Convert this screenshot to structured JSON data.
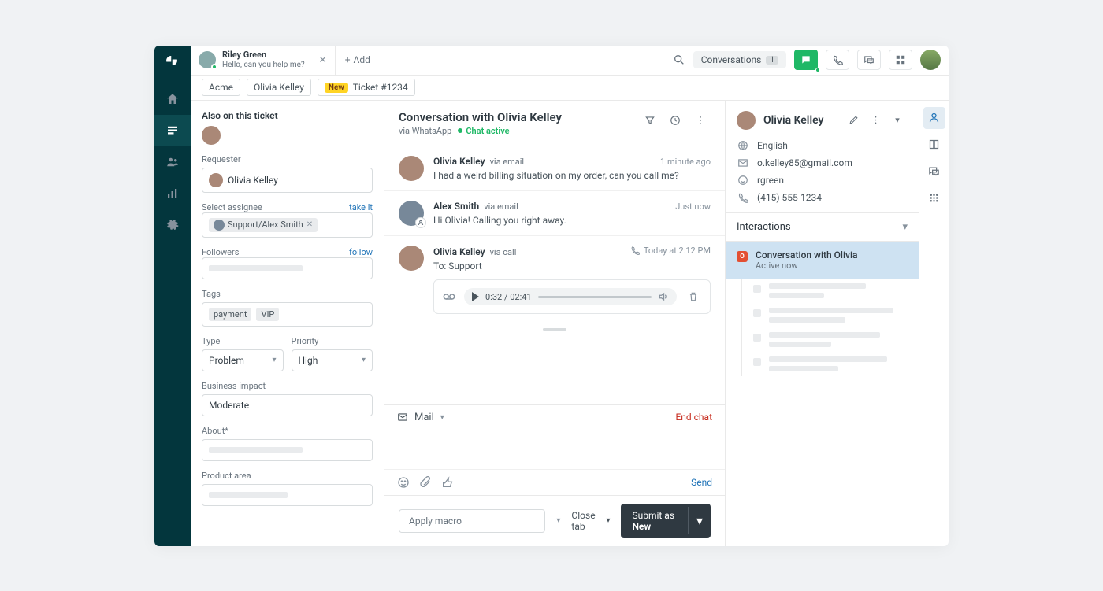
{
  "topbar": {
    "tab": {
      "name": "Riley Green",
      "preview": "Hello, can you help me?"
    },
    "add": "Add",
    "conversations": {
      "label": "Conversations",
      "count": "1"
    }
  },
  "breadcrumb": {
    "org": "Acme",
    "user": "Olivia Kelley",
    "ticket_badge": "New",
    "ticket": "Ticket #1234"
  },
  "left": {
    "also_on": "Also on this ticket",
    "requester_label": "Requester",
    "requester": "Olivia Kelley",
    "assignee_label": "Select assignee",
    "take_it": "take it",
    "assignee_chip": "Support/Alex Smith",
    "followers_label": "Followers",
    "follow": "follow",
    "tags_label": "Tags",
    "tag1": "payment",
    "tag2": "VIP",
    "type_label": "Type",
    "type_value": "Problem",
    "priority_label": "Priority",
    "priority_value": "High",
    "impact_label": "Business impact",
    "impact_value": "Moderate",
    "about_label": "About*",
    "product_label": "Product area"
  },
  "conversation": {
    "title": "Conversation with Olivia Kelley",
    "via": "via WhatsApp",
    "status": "Chat active",
    "messages": [
      {
        "author": "Olivia Kelley",
        "via": "via email",
        "time": "1 minute ago",
        "text": "I had a weird billing situation on my order, can you call me?"
      },
      {
        "author": "Alex Smith",
        "via": "via email",
        "time": "Just now",
        "text": "Hi Olivia! Calling you right away."
      },
      {
        "author": "Olivia Kelley",
        "via": "via call",
        "time": "Today at 2:12 PM",
        "to": "To: Support",
        "player_time": "0:32 / 02:41"
      }
    ],
    "reply_channel": "Mail",
    "end_chat": "End chat",
    "send": "Send",
    "macro": "Apply macro",
    "close_tab": "Close tab",
    "submit_prefix": "Submit as ",
    "submit_status": "New"
  },
  "customer": {
    "name": "Olivia Kelley",
    "language": "English",
    "email": "o.kelley85@gmail.com",
    "whatsapp": "rgreen",
    "phone": "(415) 555-1234",
    "interactions_title": "Interactions",
    "active_interaction": {
      "title": "Conversation with Olivia",
      "sub": "Active now"
    }
  }
}
